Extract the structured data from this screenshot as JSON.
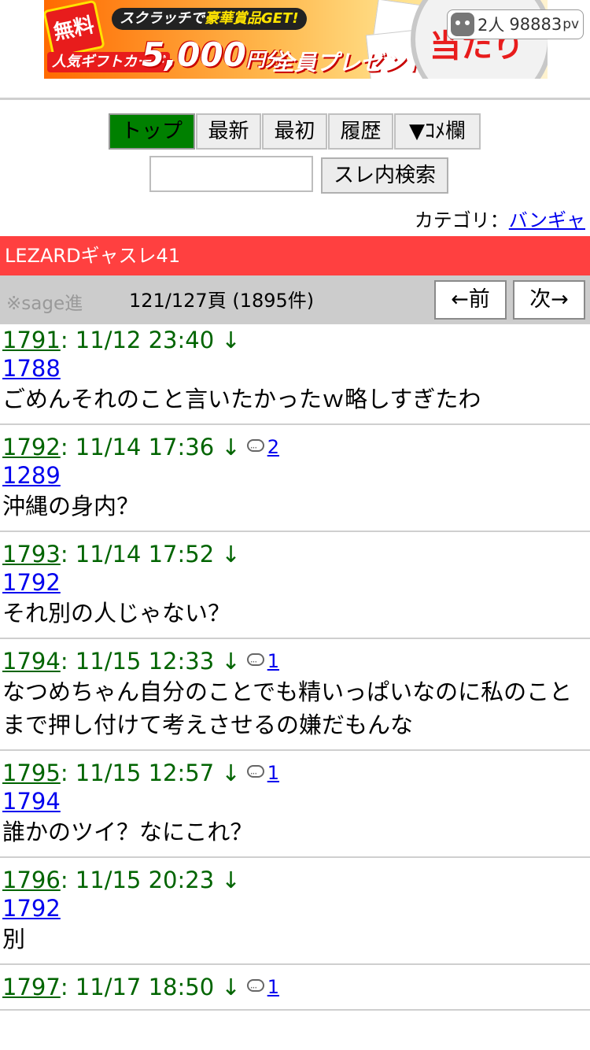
{
  "banner": {
    "free": "無料",
    "scratch_prefix": "スクラッチで",
    "scratch_highlight": "豪華賞品GET!",
    "gift_label": "人気ギフトカード",
    "amount": "5,000",
    "amount_unit": "円分",
    "present": "全員プレゼント!!",
    "hit": "当たり"
  },
  "counter": {
    "people": "2人",
    "views": "98883",
    "views_unit": "pv"
  },
  "nav": {
    "top": "トップ",
    "latest": "最新",
    "first": "最初",
    "history": "履歴",
    "comment": "▼ｺﾒ欄"
  },
  "search": {
    "value": "",
    "button": "スレ内検索"
  },
  "category": {
    "label": "カテゴリ：",
    "link": "バンギャ"
  },
  "thread": {
    "title": "LEZARDギャスレ41"
  },
  "pager": {
    "sage": "※sage進",
    "info": "121/127頁 (1895件)",
    "prev": "←前",
    "next": "次→"
  },
  "posts": [
    {
      "num": "1791",
      "time": ": 11/12 23:40 ↓",
      "replies": "",
      "anchor": "1788",
      "body": "ごめんそれのこと言いたかったｗ略しすぎたわ"
    },
    {
      "num": "1792",
      "time": ": 11/14 17:36 ↓",
      "replies": "2",
      "anchor": "1289",
      "body": "沖縄の身内？"
    },
    {
      "num": "1793",
      "time": ": 11/14 17:52 ↓",
      "replies": "",
      "anchor": "1792",
      "body": "それ別の人じゃない？"
    },
    {
      "num": "1794",
      "time": ": 11/15 12:33 ↓",
      "replies": "1",
      "anchor": "",
      "body": "なつめちゃん自分のことでも精いっぱいなのに私のことまで押し付けて考えさせるの嫌だもんな"
    },
    {
      "num": "1795",
      "time": ": 11/15 12:57 ↓",
      "replies": "1",
      "anchor": "1794",
      "body": "誰かのツイ？なにこれ？"
    },
    {
      "num": "1796",
      "time": ": 11/15 20:23 ↓",
      "replies": "",
      "anchor": "1792",
      "body": "別"
    },
    {
      "num": "1797",
      "time": ": 11/17 18:50 ↓",
      "replies": "1",
      "anchor": "",
      "body": ""
    }
  ]
}
